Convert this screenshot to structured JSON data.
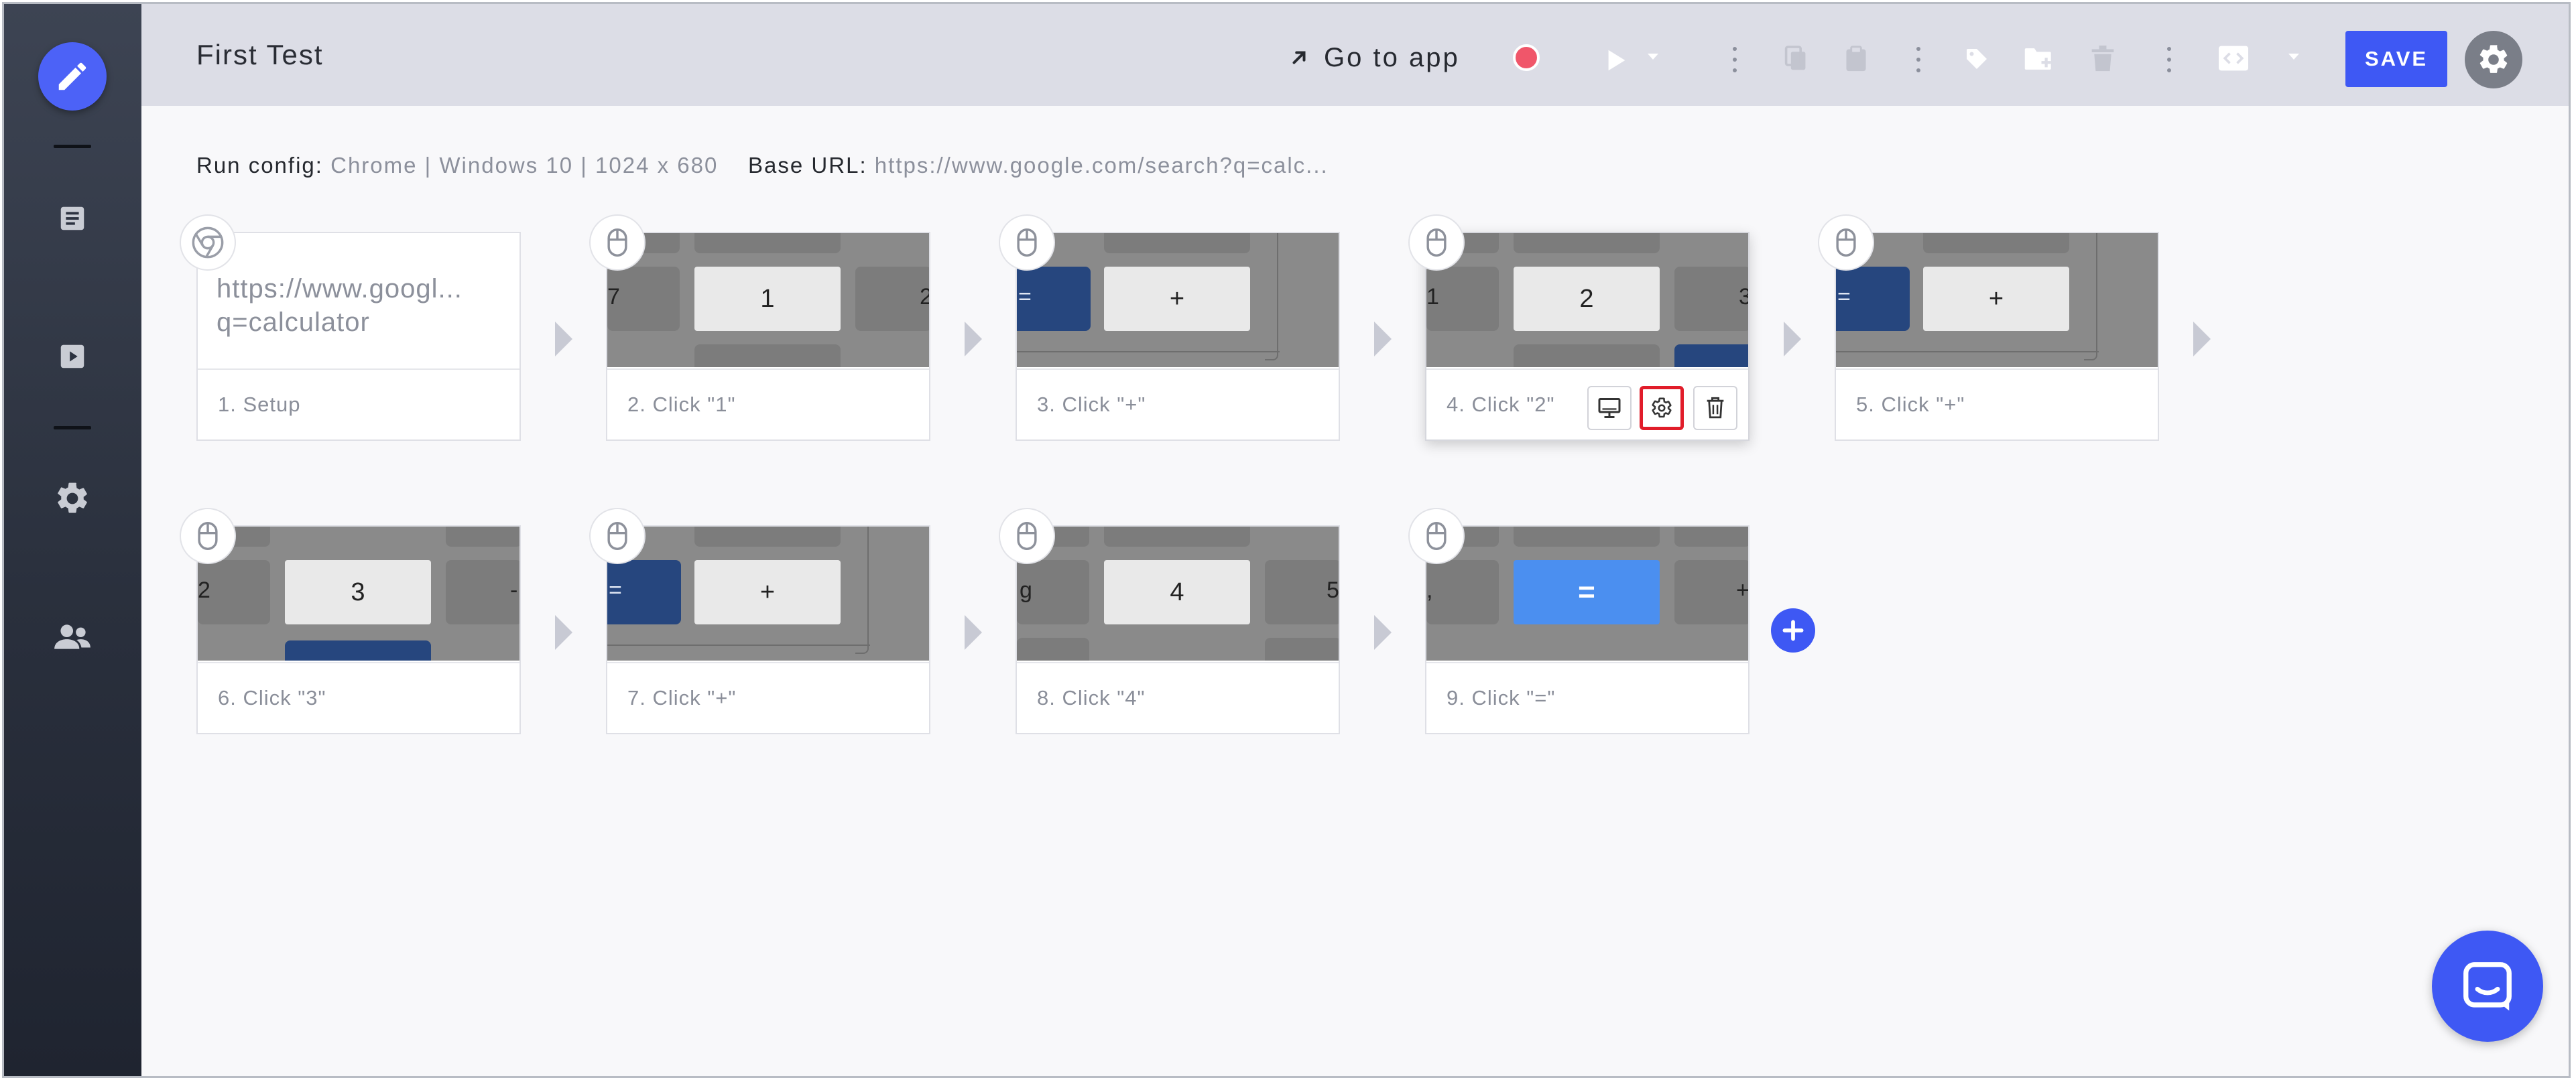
{
  "header": {
    "title": "First Test",
    "go_to_app": "Go to app",
    "save_label": "SAVE"
  },
  "run_config": {
    "label": "Run config:",
    "value": "Chrome | Windows 10 | 1024 x 680",
    "base_url_label": "Base URL:",
    "base_url": "https://www.google.com/search?q=calc..."
  },
  "steps": [
    {
      "label": "1. Setup",
      "url_line1": "https://www.googl...",
      "url_line2": "q=calculator",
      "icon": "chrome-icon"
    },
    {
      "label": "2. Click \"1\"",
      "key": "1",
      "left_edge": "7",
      "right_edge": "2",
      "icon": "mouse-icon"
    },
    {
      "label": "3. Click \"+\"",
      "key": "+",
      "left_edge": "=",
      "right_edge": "",
      "icon": "mouse-icon"
    },
    {
      "label": "4. Click \"2\"",
      "key": "2",
      "left_edge": "1",
      "right_edge": "3",
      "icon": "mouse-icon"
    },
    {
      "label": "5. Click \"+\"",
      "key": "+",
      "left_edge": "=",
      "right_edge": "",
      "icon": "mouse-icon"
    },
    {
      "label": "6. Click \"3\"",
      "key": "3",
      "left_edge": "2",
      "right_edge": "-",
      "icon": "mouse-icon"
    },
    {
      "label": "7. Click \"+\"",
      "key": "+",
      "left_edge": "=",
      "right_edge": "",
      "icon": "mouse-icon"
    },
    {
      "label": "8. Click \"4\"",
      "key": "4",
      "left_edge": "g",
      "right_edge": "5",
      "icon": "mouse-icon"
    },
    {
      "label": "9. Click \"=\"",
      "key": "=",
      "left_edge": ",",
      "right_edge": "+",
      "icon": "mouse-icon"
    }
  ],
  "colors": {
    "accent": "#3e58f4",
    "record": "#f0566a",
    "highlight": "#e11d2a"
  }
}
